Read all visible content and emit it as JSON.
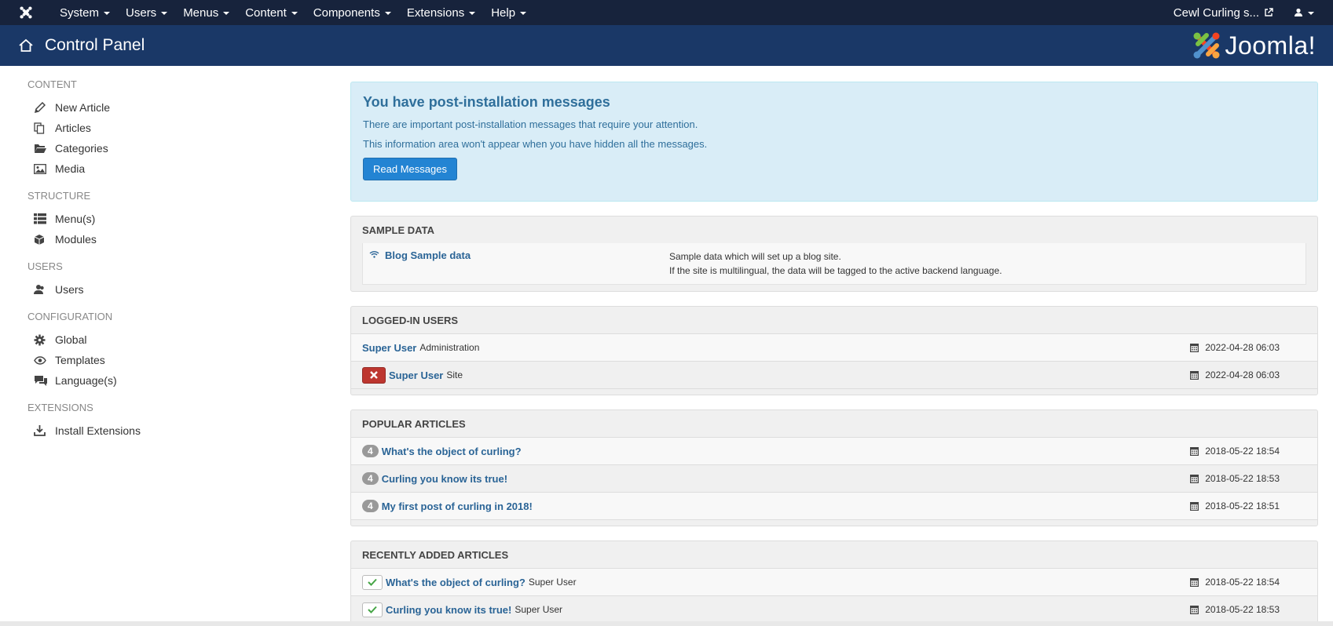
{
  "navbar": {
    "menu": [
      "System",
      "Users",
      "Menus",
      "Content",
      "Components",
      "Extensions",
      "Help"
    ],
    "site_name": "Cewl Curling s..."
  },
  "header": {
    "title": "Control Panel",
    "brand": "Joomla!"
  },
  "sidebar": {
    "sections": [
      {
        "title": "CONTENT",
        "items": [
          {
            "label": "New Article",
            "icon": "pencil-icon"
          },
          {
            "label": "Articles",
            "icon": "copy-icon"
          },
          {
            "label": "Categories",
            "icon": "folder-open-icon"
          },
          {
            "label": "Media",
            "icon": "image-icon"
          }
        ]
      },
      {
        "title": "STRUCTURE",
        "items": [
          {
            "label": "Menu(s)",
            "icon": "list-icon"
          },
          {
            "label": "Modules",
            "icon": "cube-icon"
          }
        ]
      },
      {
        "title": "USERS",
        "items": [
          {
            "label": "Users",
            "icon": "users-icon"
          }
        ]
      },
      {
        "title": "CONFIGURATION",
        "items": [
          {
            "label": "Global",
            "icon": "cog-icon"
          },
          {
            "label": "Templates",
            "icon": "eye-icon"
          },
          {
            "label": "Language(s)",
            "icon": "comments-icon"
          }
        ]
      },
      {
        "title": "EXTENSIONS",
        "items": [
          {
            "label": "Install Extensions",
            "icon": "download-icon"
          }
        ]
      }
    ]
  },
  "alert": {
    "heading": "You have post-installation messages",
    "line1": "There are important post-installation messages that require your attention.",
    "line2": "This information area won't appear when you have hidden all the messages.",
    "button": "Read Messages"
  },
  "sample_data": {
    "title": "SAMPLE DATA",
    "item_label": "Blog Sample data",
    "desc1": "Sample data which will set up a blog site.",
    "desc2": "If the site is multilingual, the data will be tagged to the active backend language."
  },
  "logged_in": {
    "title": "LOGGED-IN USERS",
    "rows": [
      {
        "user": "Super User",
        "client": "Administration",
        "date": "2022-04-28 06:03"
      },
      {
        "user": "Super User",
        "client": "Site",
        "date": "2022-04-28 06:03"
      }
    ]
  },
  "popular": {
    "title": "POPULAR ARTICLES",
    "rows": [
      {
        "hits": "4",
        "title": "What's the object of curling?",
        "date": "2018-05-22 18:54"
      },
      {
        "hits": "4",
        "title": "Curling you know its true!",
        "date": "2018-05-22 18:53"
      },
      {
        "hits": "4",
        "title": "My first post of curling in 2018!",
        "date": "2018-05-22 18:51"
      }
    ]
  },
  "recent": {
    "title": "RECENTLY ADDED ARTICLES",
    "rows": [
      {
        "title": "What's the object of curling?",
        "author": "Super User",
        "date": "2018-05-22 18:54"
      },
      {
        "title": "Curling you know its true!",
        "author": "Super User",
        "date": "2018-05-22 18:53"
      }
    ]
  }
}
